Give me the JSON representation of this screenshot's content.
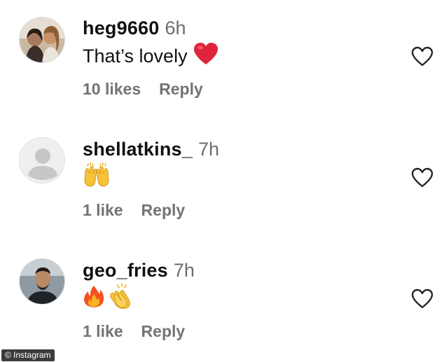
{
  "comments": [
    {
      "username": "heg9660",
      "time": "6h",
      "text": "That’s lovely",
      "emojis": [
        "red-heart"
      ],
      "likes": "10 likes",
      "reply": "Reply"
    },
    {
      "username": "shellatkins_",
      "time": "7h",
      "text": "",
      "emojis": [
        "raising-hands"
      ],
      "likes": "1 like",
      "reply": "Reply"
    },
    {
      "username": "geo_fries",
      "time": "7h",
      "text": "",
      "emojis": [
        "fire",
        "clapping-hands"
      ],
      "likes": "1 like",
      "reply": "Reply"
    }
  ],
  "watermark": "© Instagram",
  "colors": {
    "username": "#111111",
    "meta": "#737373",
    "heart_emoji": "#e0243b",
    "outline_icon": "#262626"
  }
}
